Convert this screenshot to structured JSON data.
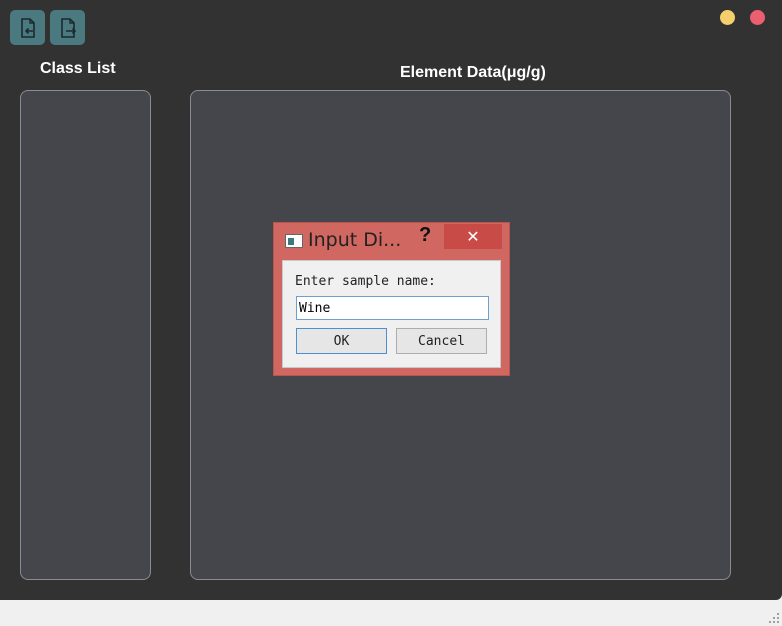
{
  "toolbar": {
    "import_icon": "import-file-icon",
    "export_icon": "export-file-icon",
    "accent": "#4a7a7f"
  },
  "window_controls": {
    "minimize_color": "#f5cf6c",
    "close_color": "#ec5f6e"
  },
  "class_list": {
    "title": "Class List"
  },
  "element_data": {
    "title": "Element Data(μg/g)"
  },
  "dialog": {
    "title": "Input Di...",
    "help_label": "?",
    "close_label": "✕",
    "prompt": "Enter sample name:",
    "input_value": "Wine",
    "ok_label": "OK",
    "cancel_label": "Cancel"
  }
}
